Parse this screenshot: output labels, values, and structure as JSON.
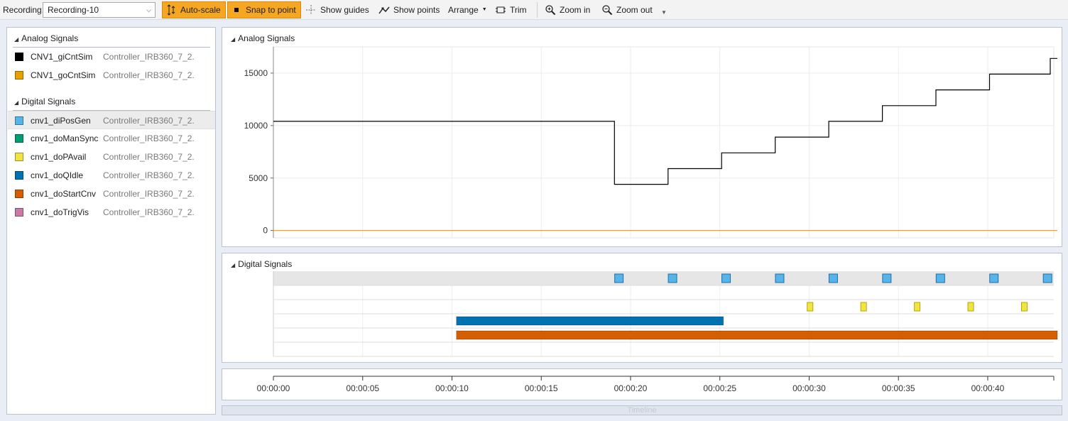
{
  "toolbar": {
    "recording_label": "Recording:",
    "recording_value": "Recording-10",
    "buttons": [
      {
        "id": "autoscale",
        "label": "Auto-scale",
        "active": true,
        "icon": "autoscale-icon"
      },
      {
        "id": "snap",
        "label": "Snap to point",
        "active": true,
        "icon": "snap-icon"
      },
      {
        "id": "guides",
        "label": "Show guides",
        "active": false,
        "icon": "crosshair-icon"
      },
      {
        "id": "points",
        "label": "Show points",
        "active": false,
        "icon": "points-icon"
      },
      {
        "id": "arrange",
        "label": "Arrange",
        "active": false,
        "icon": "dropdown-icon"
      },
      {
        "id": "trim",
        "label": "Trim",
        "active": false,
        "icon": "trim-icon"
      },
      {
        "id": "zoomin",
        "label": "Zoom in",
        "active": false,
        "icon": "zoom-in-icon"
      },
      {
        "id": "zoomout",
        "label": "Zoom out",
        "active": false,
        "icon": "zoom-out-icon"
      }
    ]
  },
  "signals": {
    "analog_header": "Analog Signals",
    "digital_header": "Digital Signals",
    "analog": [
      {
        "name": "CNV1_giCntSim",
        "controller": "Controller_IRB360_7_2...",
        "color": "#000000"
      },
      {
        "name": "CNV1_goCntSim",
        "controller": "Controller_IRB360_7_2...",
        "color": "#e6a000"
      }
    ],
    "digital": [
      {
        "name": "cnv1_diPosGen",
        "controller": "Controller_IRB360_7_2...",
        "color": "#56b4e9"
      },
      {
        "name": "cnv1_doManSync",
        "controller": "Controller_IRB360_7_2...",
        "color": "#009e73"
      },
      {
        "name": "cnv1_doPAvail",
        "controller": "Controller_IRB360_7_2...",
        "color": "#f0e442"
      },
      {
        "name": "cnv1_doQIdle",
        "controller": "Controller_IRB360_7_2...",
        "color": "#0072b2"
      },
      {
        "name": "cnv1_doStartCnv",
        "controller": "Controller_IRB360_7_2...",
        "color": "#d55e00"
      },
      {
        "name": "cnv1_doTrigVis",
        "controller": "Controller_IRB360_7_2...",
        "color": "#cc79a7"
      }
    ]
  },
  "analog_panel": {
    "title": "Analog Signals"
  },
  "digital_panel": {
    "title": "Digital Signals"
  },
  "timeline": {
    "label": "Timeline"
  },
  "chart_data": {
    "type": "line",
    "x_unit": "seconds",
    "xlim": [
      0,
      43.7
    ],
    "ylim": [
      -700,
      17500
    ],
    "yticks": [
      0,
      5000,
      10000,
      15000
    ],
    "xticks": [
      "00:00:00",
      "00:00:05",
      "00:00:10",
      "00:00:15",
      "00:00:20",
      "00:00:25",
      "00:00:30",
      "00:00:35",
      "00:00:40"
    ],
    "grid": true,
    "series": [
      {
        "name": "CNV1_giCntSim",
        "color": "#000000",
        "step_x": [
          0,
          19.1,
          19.1,
          22.1,
          22.1,
          25.1,
          25.1,
          28.1,
          28.1,
          31.1,
          31.1,
          34.1,
          34.1,
          37.1,
          37.1,
          40.1,
          40.1,
          43.5,
          43.5,
          43.9
        ],
        "step_y": [
          10400,
          10400,
          4400,
          4400,
          5900,
          5900,
          7400,
          7400,
          8900,
          8900,
          10400,
          10400,
          11900,
          11900,
          13400,
          13400,
          14900,
          14900,
          16400,
          16400
        ]
      },
      {
        "name": "CNV1_goCntSim",
        "color": "#e6a000",
        "step_x": [
          0,
          43.9
        ],
        "step_y": [
          0,
          0
        ]
      }
    ],
    "digital": [
      {
        "name": "cnv1_diPosGen",
        "color": "#56b4e9",
        "pulses": [
          19.35,
          22.35,
          25.35,
          28.35,
          31.35,
          34.35,
          37.35,
          40.35,
          43.35
        ],
        "highlight": true
      },
      {
        "name": "cnv1_doManSync",
        "color": "#009e73",
        "pulses": []
      },
      {
        "name": "cnv1_doPAvail",
        "color": "#f0e442",
        "pulses": [
          30.05,
          33.05,
          36.05,
          39.05,
          42.05
        ]
      },
      {
        "name": "cnv1_doQIdle",
        "color": "#0072b2",
        "intervals": [
          [
            10.25,
            25.2
          ]
        ]
      },
      {
        "name": "cnv1_doStartCnv",
        "color": "#d55e00",
        "intervals": [
          [
            10.25,
            43.9
          ]
        ]
      },
      {
        "name": "cnv1_doTrigVis",
        "color": "#cc79a7",
        "intervals": []
      }
    ]
  }
}
